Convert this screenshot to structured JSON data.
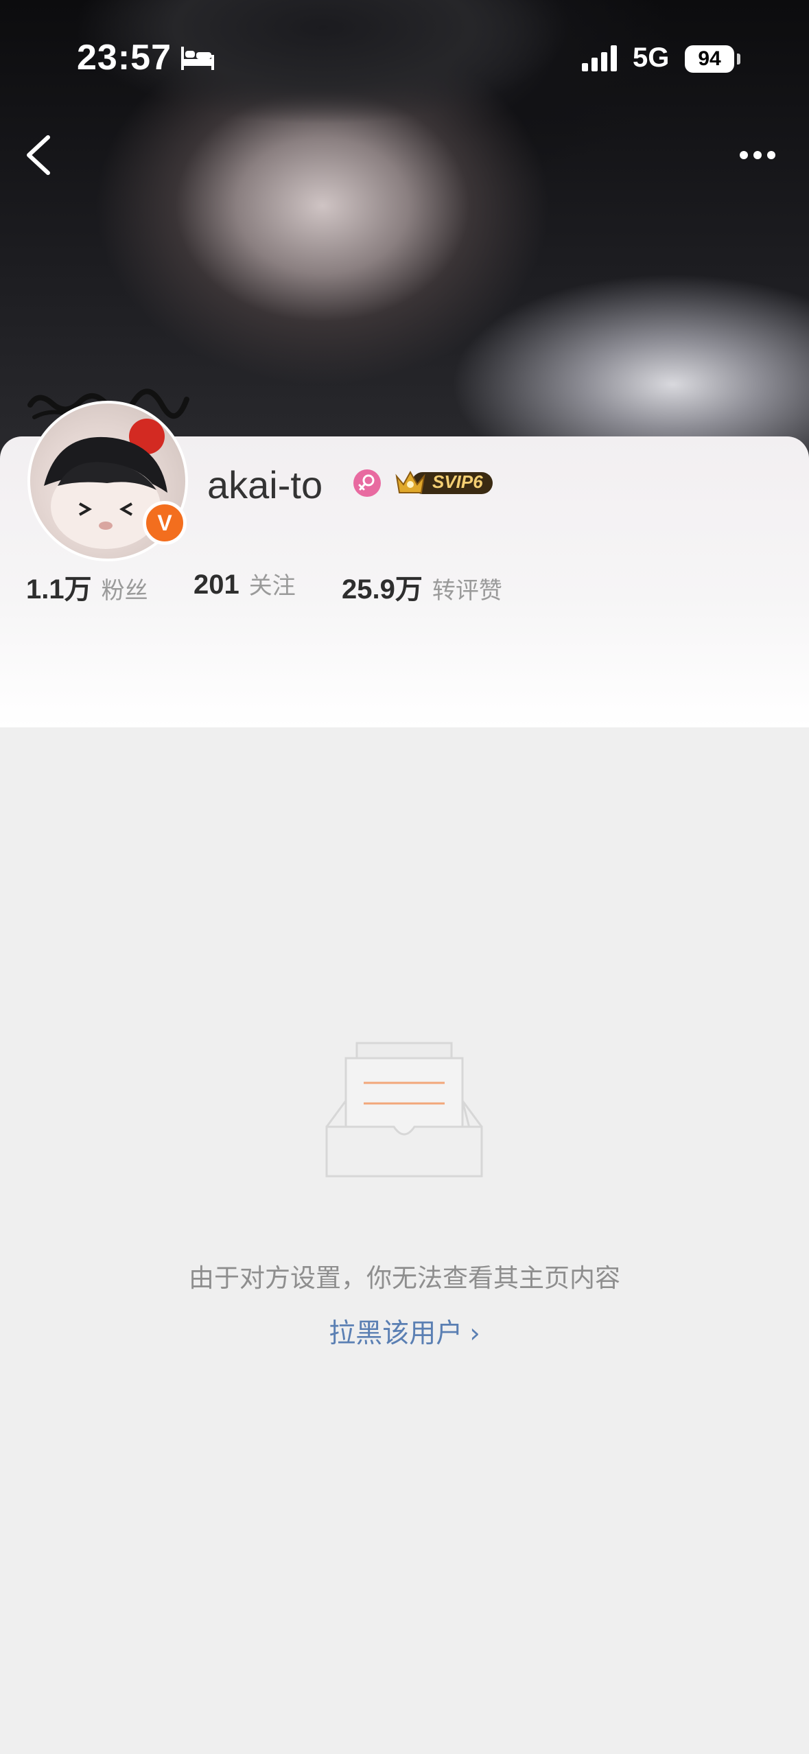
{
  "status_bar": {
    "time": "23:57",
    "network": "5G",
    "battery": "94"
  },
  "profile": {
    "username": "akai-to",
    "vip_badge": "SVIP6",
    "verified_mark": "V",
    "stats": [
      {
        "value": "1.1万",
        "label": "粉丝"
      },
      {
        "value": "201",
        "label": "关注"
      },
      {
        "value": "25.9万",
        "label": "转评赞"
      }
    ]
  },
  "empty_state": {
    "message": "由于对方设置，你无法查看其主页内容",
    "block_link": "拉黑该用户",
    "block_chevron": "›"
  },
  "icons": {
    "back": "back-arrow-icon",
    "more": "more-dots-icon",
    "bed": "bed-icon",
    "signal": "signal-icon",
    "gender": "female-icon",
    "svip": "crown-icon",
    "empty": "empty-inbox-icon"
  },
  "colors": {
    "accent_orange": "#f36e1e",
    "link_blue": "#5a7fb3",
    "gender_pink": "#e86aa0",
    "svip_gold": "#e0a82b"
  }
}
